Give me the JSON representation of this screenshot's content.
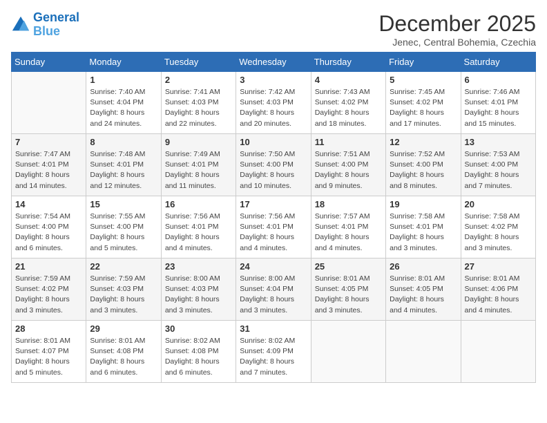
{
  "logo": {
    "line1": "General",
    "line2": "Blue"
  },
  "title": "December 2025",
  "subtitle": "Jenec, Central Bohemia, Czechia",
  "days_header": [
    "Sunday",
    "Monday",
    "Tuesday",
    "Wednesday",
    "Thursday",
    "Friday",
    "Saturday"
  ],
  "weeks": [
    [
      {
        "day": "",
        "info": ""
      },
      {
        "day": "1",
        "info": "Sunrise: 7:40 AM\nSunset: 4:04 PM\nDaylight: 8 hours\nand 24 minutes."
      },
      {
        "day": "2",
        "info": "Sunrise: 7:41 AM\nSunset: 4:03 PM\nDaylight: 8 hours\nand 22 minutes."
      },
      {
        "day": "3",
        "info": "Sunrise: 7:42 AM\nSunset: 4:03 PM\nDaylight: 8 hours\nand 20 minutes."
      },
      {
        "day": "4",
        "info": "Sunrise: 7:43 AM\nSunset: 4:02 PM\nDaylight: 8 hours\nand 18 minutes."
      },
      {
        "day": "5",
        "info": "Sunrise: 7:45 AM\nSunset: 4:02 PM\nDaylight: 8 hours\nand 17 minutes."
      },
      {
        "day": "6",
        "info": "Sunrise: 7:46 AM\nSunset: 4:01 PM\nDaylight: 8 hours\nand 15 minutes."
      }
    ],
    [
      {
        "day": "7",
        "info": "Sunrise: 7:47 AM\nSunset: 4:01 PM\nDaylight: 8 hours\nand 14 minutes."
      },
      {
        "day": "8",
        "info": "Sunrise: 7:48 AM\nSunset: 4:01 PM\nDaylight: 8 hours\nand 12 minutes."
      },
      {
        "day": "9",
        "info": "Sunrise: 7:49 AM\nSunset: 4:01 PM\nDaylight: 8 hours\nand 11 minutes."
      },
      {
        "day": "10",
        "info": "Sunrise: 7:50 AM\nSunset: 4:00 PM\nDaylight: 8 hours\nand 10 minutes."
      },
      {
        "day": "11",
        "info": "Sunrise: 7:51 AM\nSunset: 4:00 PM\nDaylight: 8 hours\nand 9 minutes."
      },
      {
        "day": "12",
        "info": "Sunrise: 7:52 AM\nSunset: 4:00 PM\nDaylight: 8 hours\nand 8 minutes."
      },
      {
        "day": "13",
        "info": "Sunrise: 7:53 AM\nSunset: 4:00 PM\nDaylight: 8 hours\nand 7 minutes."
      }
    ],
    [
      {
        "day": "14",
        "info": "Sunrise: 7:54 AM\nSunset: 4:00 PM\nDaylight: 8 hours\nand 6 minutes."
      },
      {
        "day": "15",
        "info": "Sunrise: 7:55 AM\nSunset: 4:00 PM\nDaylight: 8 hours\nand 5 minutes."
      },
      {
        "day": "16",
        "info": "Sunrise: 7:56 AM\nSunset: 4:01 PM\nDaylight: 8 hours\nand 4 minutes."
      },
      {
        "day": "17",
        "info": "Sunrise: 7:56 AM\nSunset: 4:01 PM\nDaylight: 8 hours\nand 4 minutes."
      },
      {
        "day": "18",
        "info": "Sunrise: 7:57 AM\nSunset: 4:01 PM\nDaylight: 8 hours\nand 4 minutes."
      },
      {
        "day": "19",
        "info": "Sunrise: 7:58 AM\nSunset: 4:01 PM\nDaylight: 8 hours\nand 3 minutes."
      },
      {
        "day": "20",
        "info": "Sunrise: 7:58 AM\nSunset: 4:02 PM\nDaylight: 8 hours\nand 3 minutes."
      }
    ],
    [
      {
        "day": "21",
        "info": "Sunrise: 7:59 AM\nSunset: 4:02 PM\nDaylight: 8 hours\nand 3 minutes."
      },
      {
        "day": "22",
        "info": "Sunrise: 7:59 AM\nSunset: 4:03 PM\nDaylight: 8 hours\nand 3 minutes."
      },
      {
        "day": "23",
        "info": "Sunrise: 8:00 AM\nSunset: 4:03 PM\nDaylight: 8 hours\nand 3 minutes."
      },
      {
        "day": "24",
        "info": "Sunrise: 8:00 AM\nSunset: 4:04 PM\nDaylight: 8 hours\nand 3 minutes."
      },
      {
        "day": "25",
        "info": "Sunrise: 8:01 AM\nSunset: 4:05 PM\nDaylight: 8 hours\nand 3 minutes."
      },
      {
        "day": "26",
        "info": "Sunrise: 8:01 AM\nSunset: 4:05 PM\nDaylight: 8 hours\nand 4 minutes."
      },
      {
        "day": "27",
        "info": "Sunrise: 8:01 AM\nSunset: 4:06 PM\nDaylight: 8 hours\nand 4 minutes."
      }
    ],
    [
      {
        "day": "28",
        "info": "Sunrise: 8:01 AM\nSunset: 4:07 PM\nDaylight: 8 hours\nand 5 minutes."
      },
      {
        "day": "29",
        "info": "Sunrise: 8:01 AM\nSunset: 4:08 PM\nDaylight: 8 hours\nand 6 minutes."
      },
      {
        "day": "30",
        "info": "Sunrise: 8:02 AM\nSunset: 4:08 PM\nDaylight: 8 hours\nand 6 minutes."
      },
      {
        "day": "31",
        "info": "Sunrise: 8:02 AM\nSunset: 4:09 PM\nDaylight: 8 hours\nand 7 minutes."
      },
      {
        "day": "",
        "info": ""
      },
      {
        "day": "",
        "info": ""
      },
      {
        "day": "",
        "info": ""
      }
    ]
  ]
}
